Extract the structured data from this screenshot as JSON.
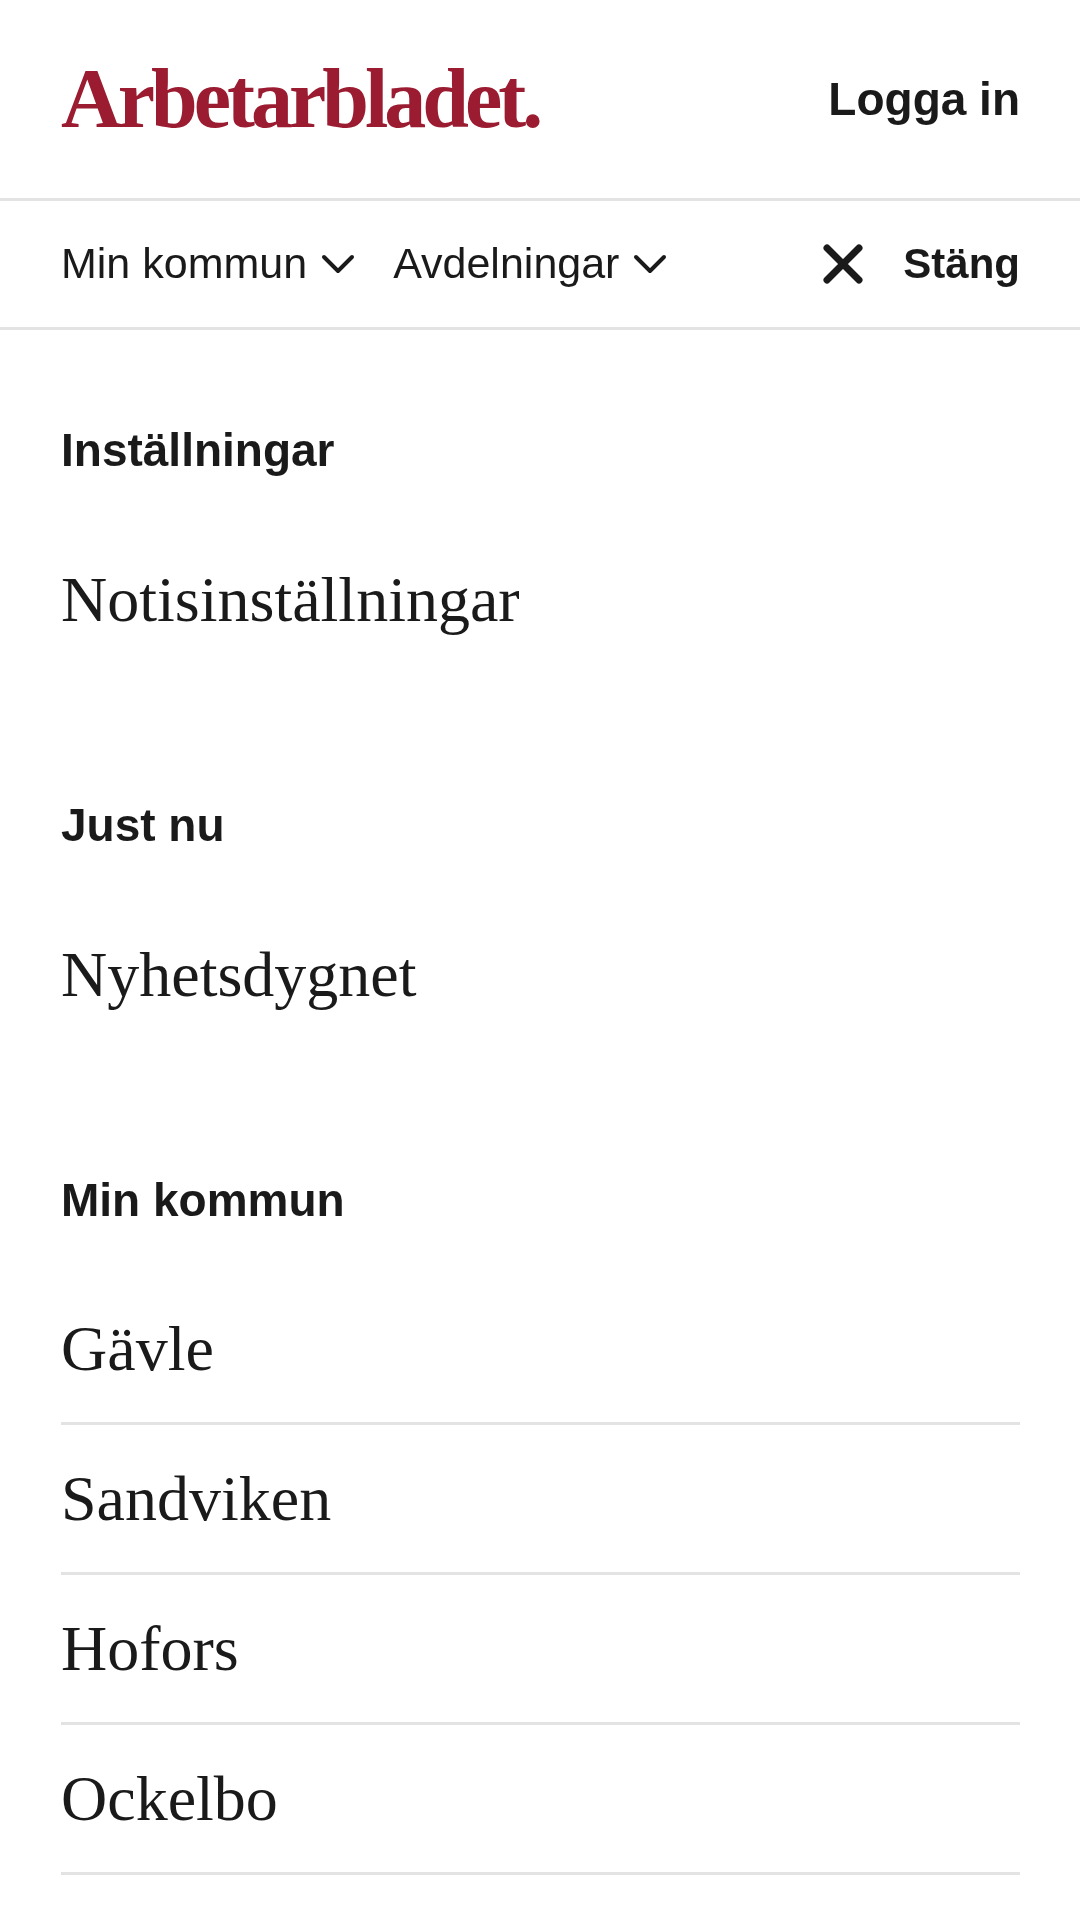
{
  "header": {
    "logo": "Arbetarbladet.",
    "login": "Logga in"
  },
  "nav": {
    "menus": [
      {
        "label": "Min kommun"
      },
      {
        "label": "Avdelningar"
      }
    ],
    "close": {
      "label": "Stäng"
    }
  },
  "sections": [
    {
      "heading": "Inställningar",
      "divided": false,
      "items": [
        "Notisinställningar"
      ]
    },
    {
      "heading": "Just nu",
      "divided": false,
      "items": [
        "Nyhetsdygnet"
      ]
    },
    {
      "heading": "Min kommun",
      "divided": true,
      "items": [
        "Gävle",
        "Sandviken",
        "Hofors",
        "Ockelbo"
      ]
    }
  ]
}
